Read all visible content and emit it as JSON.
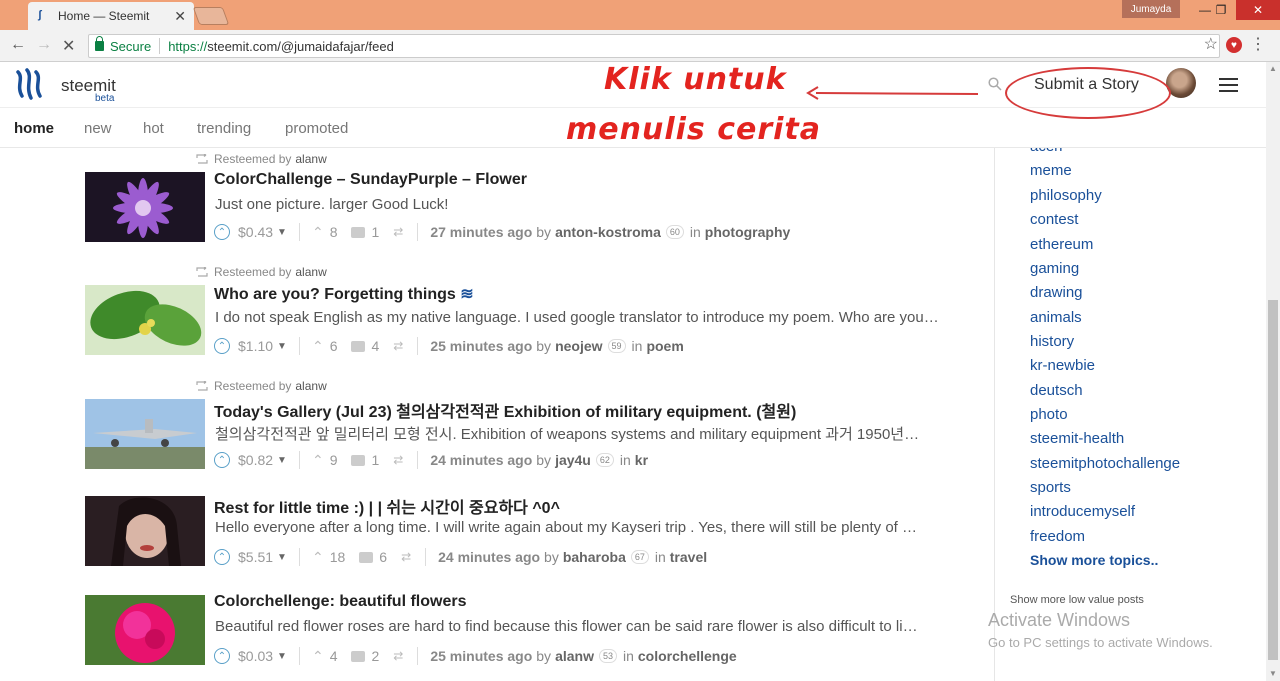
{
  "browser": {
    "tab_title": "Home — Steemit",
    "tab_close": "✕",
    "user_chip": "Jumayda",
    "secure_label": "Secure",
    "url_scheme": "https://",
    "url_rest": "steemit.com/@jumaidafajar/feed",
    "window_controls": {
      "minimize": "—",
      "maximize": "❐",
      "close": "✕"
    }
  },
  "header": {
    "brand": "steemit",
    "beta": "beta",
    "submit_label": "Submit a Story"
  },
  "annotation": {
    "line1": "Klik untuk",
    "line2": "menulis cerita",
    "color": "#e3241f"
  },
  "nav": {
    "tabs": [
      "home",
      "new",
      "hot",
      "trending",
      "promoted"
    ]
  },
  "posts": [
    {
      "resteemed_prefix": "Resteemed by",
      "resteemed_by": "alanw",
      "title": "ColorChallenge – SundayPurple – Flower",
      "body": "Just one picture. larger Good Luck!",
      "payout": "$0.43",
      "votes": "8",
      "comments": "1",
      "time": "27 minutes ago",
      "by": "by",
      "author": "anton-kostroma",
      "rep": "60",
      "in": "in",
      "category": "photography"
    },
    {
      "resteemed_prefix": "Resteemed by",
      "resteemed_by": "alanw",
      "title": "Who are you? Forgetting things",
      "body": "I do not speak English as my native language. I used google translator to introduce my poem. Who are you…",
      "payout": "$1.10",
      "votes": "6",
      "comments": "4",
      "time": "25 minutes ago",
      "by": "by",
      "author": "neojew",
      "rep": "59",
      "in": "in",
      "category": "poem"
    },
    {
      "resteemed_prefix": "Resteemed by",
      "resteemed_by": "alanw",
      "title": "Today's Gallery (Jul 23) 철의삼각전적관 Exhibition of military equipment. (철원)",
      "body": "철의삼각전적관 앞 밀리터리 모형 전시. Exhibition of weapons systems and military equipment 과거 1950년…",
      "payout": "$0.82",
      "votes": "9",
      "comments": "1",
      "time": "24 minutes ago",
      "by": "by",
      "author": "jay4u",
      "rep": "62",
      "in": "in",
      "category": "kr"
    },
    {
      "title": "Rest for little time :) | | 쉬는 시간이 중요하다 ^0^",
      "body": "Hello everyone after a long time. I will write again about my Kayseri trip . Yes, there will still be plenty of …",
      "payout": "$5.51",
      "votes": "18",
      "comments": "6",
      "time": "24 minutes ago",
      "by": "by",
      "author": "baharoba",
      "rep": "67",
      "in": "in",
      "category": "travel"
    },
    {
      "title": "Colorchellenge: beautiful flowers",
      "body": "Beautiful red flower roses are hard to find because this flower can be said rare flower is also difficult to li…",
      "payout": "$0.03",
      "votes": "4",
      "comments": "2",
      "time": "25 minutes ago",
      "by": "by",
      "author": "alanw",
      "rep": "53",
      "in": "in",
      "category": "colorchellenge"
    }
  ],
  "sidebar": {
    "topics": [
      "aceh",
      "meme",
      "philosophy",
      "contest",
      "ethereum",
      "gaming",
      "drawing",
      "animals",
      "history",
      "kr-newbie",
      "deutsch",
      "photo",
      "steemit-health",
      "steemitphotochallenge",
      "sports",
      "introducemyself",
      "freedom"
    ],
    "show_more": "Show more topics..",
    "low_value": "Show more low value posts"
  },
  "watermark": {
    "line1": "Activate Windows",
    "line2": "Go to PC settings to activate Windows."
  },
  "colors": {
    "accent": "#1a5099",
    "titlebar": "#f0a177"
  }
}
